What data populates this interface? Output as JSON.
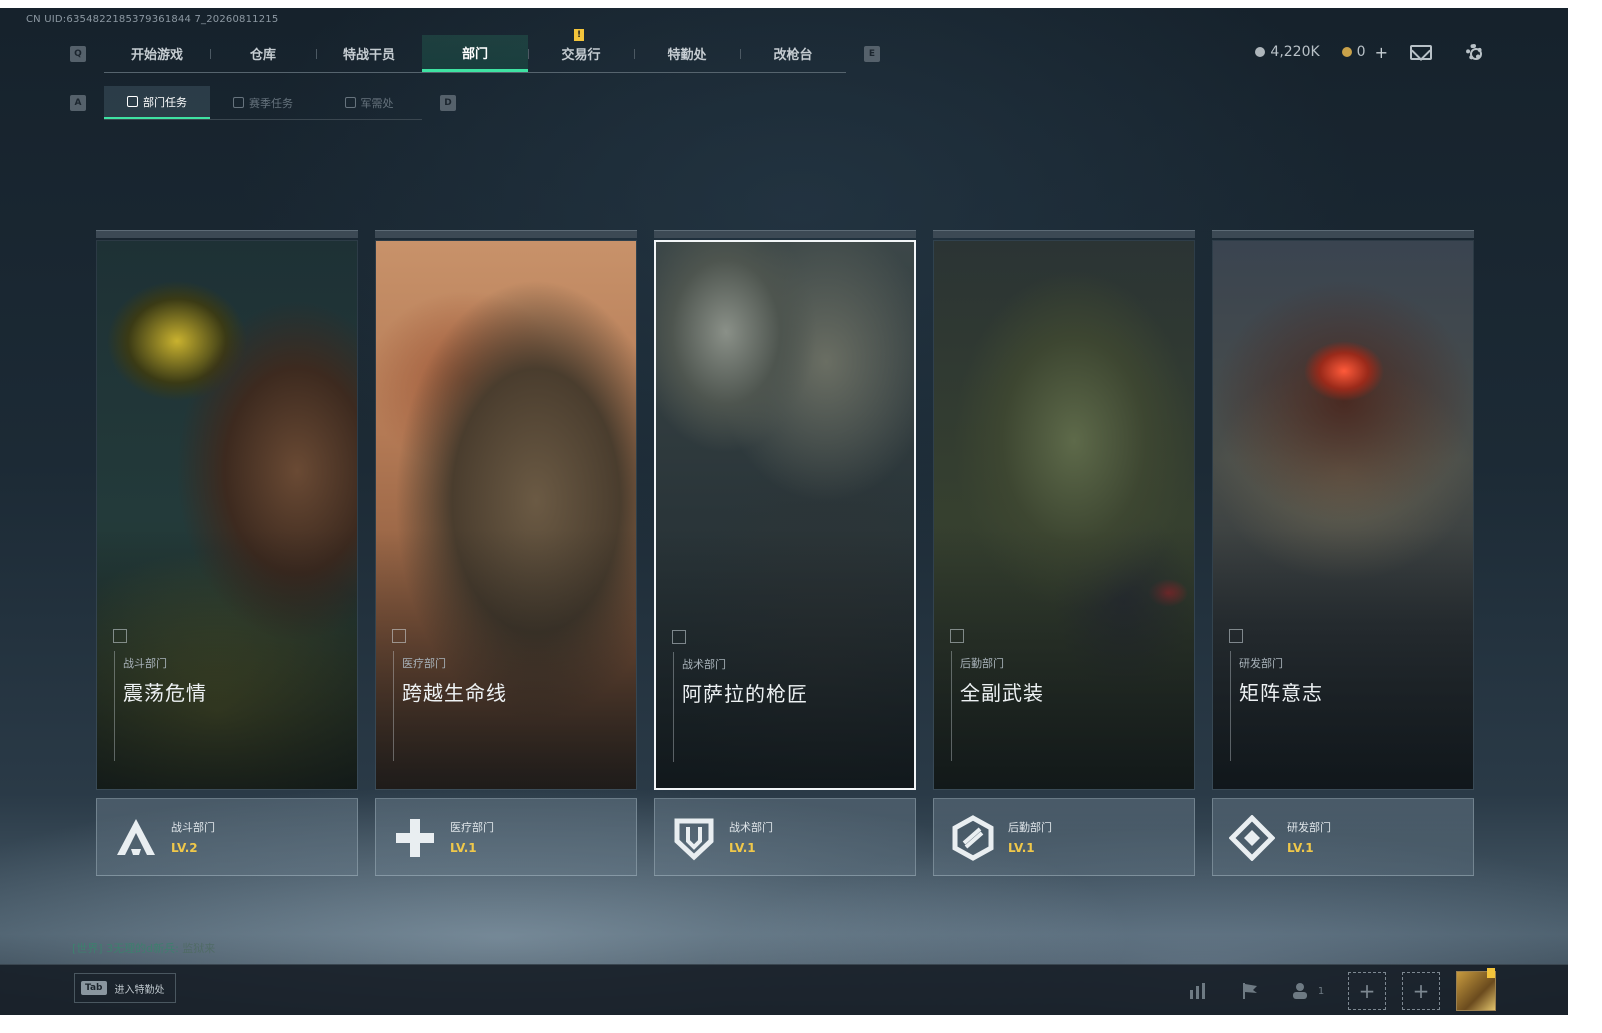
{
  "uid_text": "CN UID:6354822185379361844 7_20260811215",
  "nav": {
    "left_key": "Q",
    "right_key": "E",
    "tabs": [
      {
        "label": "开始游戏"
      },
      {
        "label": "仓库"
      },
      {
        "label": "特战干员"
      },
      {
        "label": "部门",
        "active": true
      },
      {
        "label": "交易行",
        "alert": "!"
      },
      {
        "label": "特勤处"
      },
      {
        "label": "改枪台"
      }
    ]
  },
  "subnav": {
    "left_key": "A",
    "right_key": "D",
    "tabs": [
      {
        "label": "部门任务",
        "active": true
      },
      {
        "label": "赛季任务"
      },
      {
        "label": "军需处"
      }
    ]
  },
  "currency": {
    "silver": "4,220K",
    "gold": "0",
    "gold_plus": "+"
  },
  "departments": [
    {
      "dept": "战斗部门",
      "title": "震荡危情",
      "level": "LV.2",
      "emblem": "combat-emblem-icon"
    },
    {
      "dept": "医疗部门",
      "title": "跨越生命线",
      "level": "LV.1",
      "emblem": "medical-emblem-icon"
    },
    {
      "dept": "战术部门",
      "title": "阿萨拉的枪匠",
      "level": "LV.1",
      "emblem": "tactical-emblem-icon",
      "selected": true
    },
    {
      "dept": "后勤部门",
      "title": "全副武装",
      "level": "LV.1",
      "emblem": "logistics-emblem-icon"
    },
    {
      "dept": "研发部门",
      "title": "矩阵意志",
      "level": "LV.1",
      "emblem": "research-emblem-icon"
    }
  ],
  "chat": {
    "channel": "[世界]",
    "user": "3无理的d新兵",
    "message": "监狱来"
  },
  "bottom": {
    "tab_key": "Tab",
    "tab_hint": "进入特勤处",
    "squad_count": "1",
    "slot_plus": "+"
  },
  "colors": {
    "accent": "#3fe3a3",
    "level": "#f0c84a",
    "alert": "#f3c43b"
  }
}
